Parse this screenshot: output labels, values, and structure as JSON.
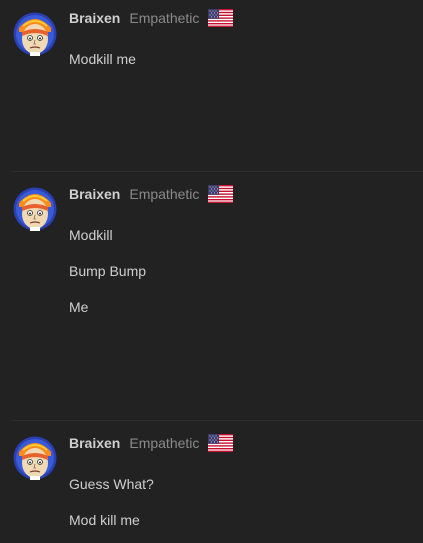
{
  "posts": [
    {
      "username": "Braixen",
      "title": "Empathetic",
      "flag_icon": "us-flag-icon",
      "lines": [
        "Modkill me"
      ]
    },
    {
      "username": "Braixen",
      "title": "Empathetic",
      "flag_icon": "us-flag-icon",
      "lines": [
        "Modkill",
        "Bump Bump",
        "Me"
      ]
    },
    {
      "username": "Braixen",
      "title": "Empathetic",
      "flag_icon": "us-flag-icon",
      "lines": [
        "Guess What?",
        "Mod kill me"
      ]
    }
  ],
  "colors": {
    "background": "#222222",
    "username": "#cfcfcf",
    "title": "#8a8a8a",
    "text": "#cfcfcf",
    "avatar_face": "#f0d9b5",
    "avatar_hair": "#ff8c1a",
    "avatar_border": "#3a5bd9"
  }
}
